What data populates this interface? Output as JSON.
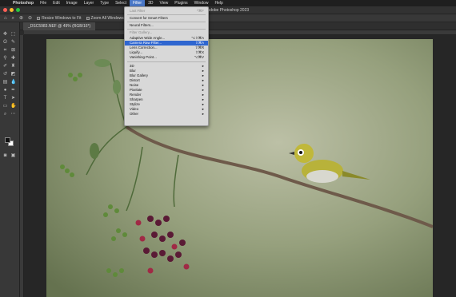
{
  "menubar": {
    "items": [
      "Photoshop",
      "File",
      "Edit",
      "Image",
      "Layer",
      "Type",
      "Select",
      "Filter",
      "3D",
      "View",
      "Plugins",
      "Window",
      "Help"
    ],
    "active": "Filter"
  },
  "window": {
    "title": "Adobe Photoshop 2023"
  },
  "options": {
    "resize_label": "Resize Windows to Fit",
    "zoom_all_label": "Zoom All Windows"
  },
  "document": {
    "tab_label": "_DSC5983.NEF @ 49% (RGB/16*)"
  },
  "filter_menu": {
    "last_filter": {
      "label": "Last Filter",
      "shortcut": "^⌘F"
    },
    "convert_smart": "Convert for Smart Filters",
    "neural": "Neural Filters...",
    "filter_gallery": "Filter Gallery...",
    "items_with_shortcuts": [
      {
        "label": "Adaptive Wide Angle...",
        "shortcut": "⌥⇧⌘A",
        "highlight": false
      },
      {
        "label": "Camera Raw Filter...",
        "shortcut": "⇧⌘A",
        "highlight": true
      },
      {
        "label": "Lens Correction...",
        "shortcut": "⇧⌘R",
        "highlight": false
      },
      {
        "label": "Liquify...",
        "shortcut": "⇧⌘X",
        "highlight": false
      },
      {
        "label": "Vanishing Point...",
        "shortcut": "⌥⌘V",
        "highlight": false
      }
    ],
    "submenus": [
      "3D",
      "Blur",
      "Blur Gallery",
      "Distort",
      "Noise",
      "Pixelate",
      "Render",
      "Sharpen",
      "Stylize",
      "Video",
      "Other"
    ]
  },
  "colors": {
    "highlight": "#2f66d0",
    "menubar_active": "#4a78c8",
    "bird_body": "#b8b23a"
  }
}
